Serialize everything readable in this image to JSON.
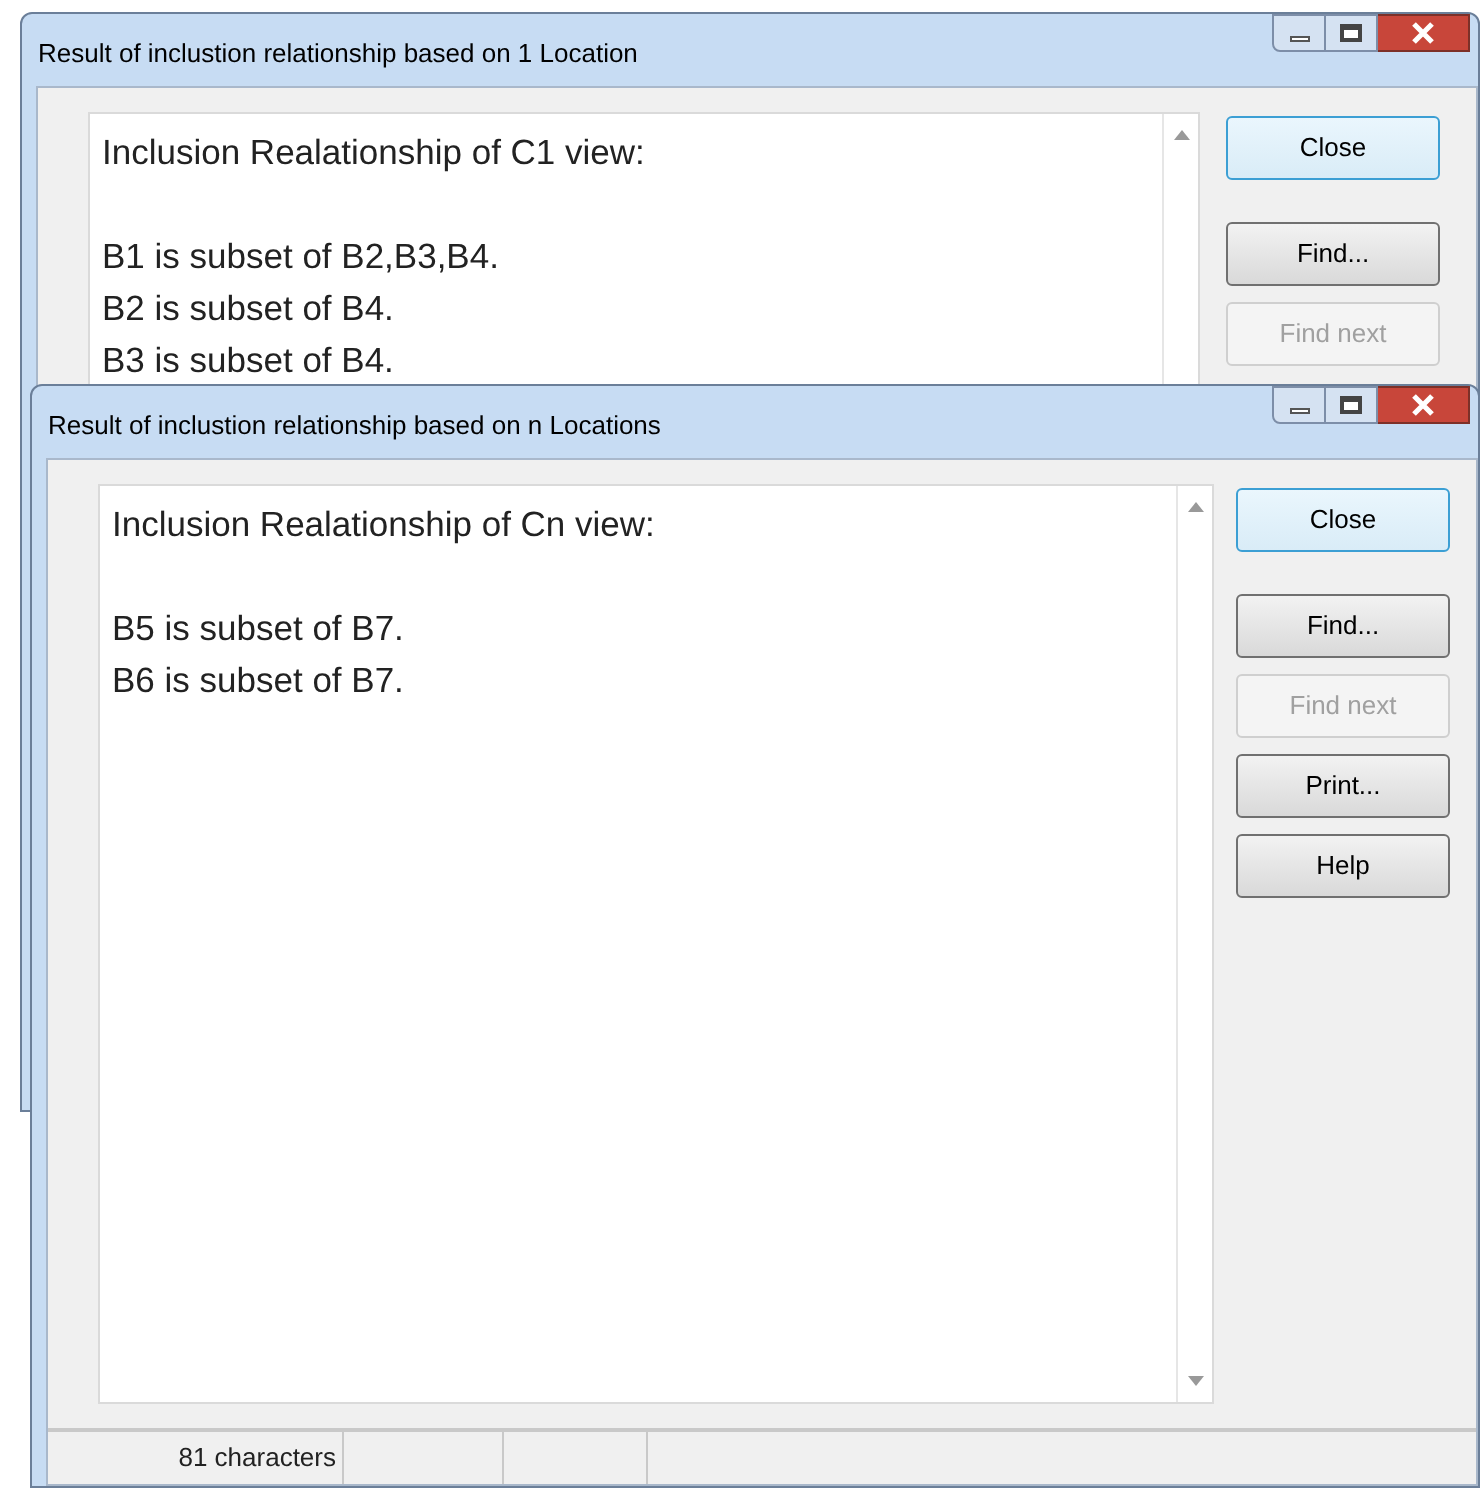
{
  "windows": [
    {
      "title": "Result of inclustion relationship based on 1 Location",
      "heading": "Inclusion Realationship of C1 view:",
      "lines": [
        "B1 is subset of B2,B3,B4.",
        "B2 is subset of B4.",
        "B3 is subset of B4."
      ],
      "buttons": [
        {
          "label": "Close",
          "default": true,
          "disabled": false
        },
        {
          "label": "Find...",
          "default": false,
          "disabled": false
        },
        {
          "label": "Find next",
          "default": false,
          "disabled": true
        }
      ]
    },
    {
      "title": "Result of inclustion relationship based on n Locations",
      "heading": "Inclusion Realationship of Cn view:",
      "lines": [
        "B5 is subset of B7.",
        "B6 is subset of B7."
      ],
      "buttons": [
        {
          "label": "Close",
          "default": true,
          "disabled": false
        },
        {
          "label": "Find...",
          "default": false,
          "disabled": false
        },
        {
          "label": "Find next",
          "default": false,
          "disabled": true
        },
        {
          "label": "Print...",
          "default": false,
          "disabled": false
        },
        {
          "label": "Help",
          "default": false,
          "disabled": false
        }
      ],
      "status_bar": [
        "81 characters"
      ]
    }
  ]
}
